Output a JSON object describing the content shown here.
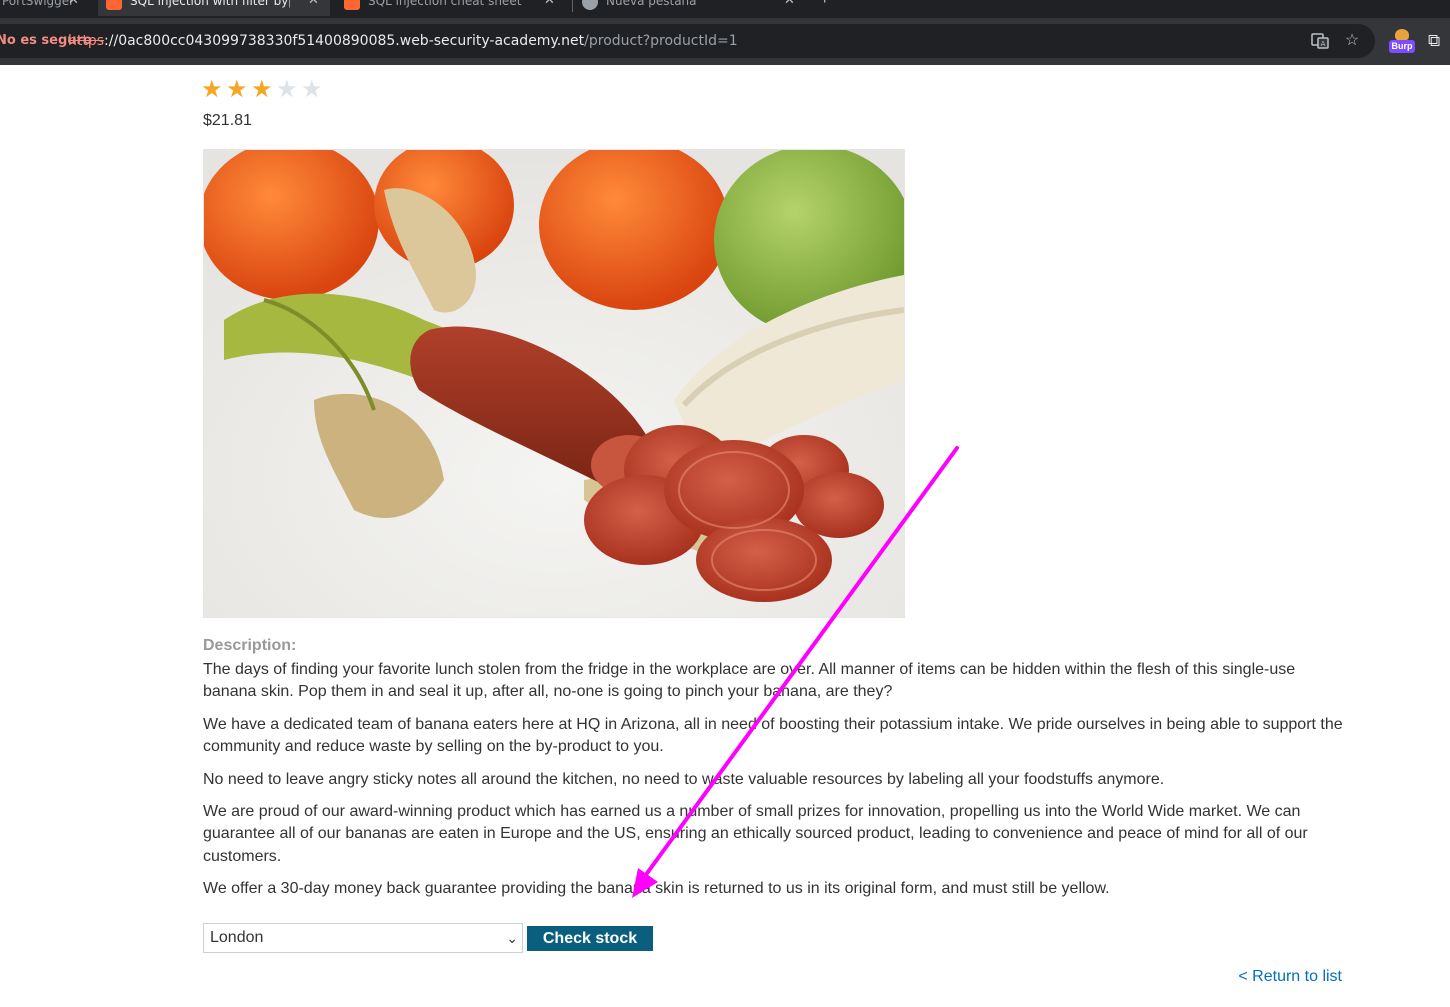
{
  "browser": {
    "tabs": [
      {
        "label": "PortSwigger"
      },
      {
        "label": "SQL injection with filter bypass"
      },
      {
        "label": "SQL injection cheat sheet"
      },
      {
        "label": "Nueva pestaña"
      }
    ],
    "security_chip": "No es seguro",
    "url": {
      "protocol": "https",
      "host": "://0ac800cc043099738330f51400890085.web-security-academy.net",
      "path": "/product?productId=1"
    },
    "extensions": {
      "burp_badge": "Burp"
    }
  },
  "product": {
    "rating": {
      "filled": 3,
      "total": 5
    },
    "price": "$21.81",
    "image_alt": "Banana skin with chorizo sausage inside",
    "description_label": "Description:",
    "description": [
      "The days of finding your favorite lunch stolen from the fridge in the workplace are over. All manner of items can be hidden within the flesh of this single-use banana skin. Pop them in and seal it up, after all, no-one is going to pinch your banana, are they?",
      "We have a dedicated team of banana eaters here at HQ in Arizona, all in need of boosting their potassium intake. We pride ourselves in being able to support the community and reduce waste by selling on the by-product to you.",
      "No need to leave angry sticky notes all around the kitchen, no need to waste valuable resources by labeling all your foodstuffs anymore.",
      "We are proud of our award-winning product which has earned us a number of small prizes for innovation, propelling us into the World Wide market. We can guarantee all of our bananas are eaten in Europe and the US, ensuring an ethically sourced product, leading to convenience and peace of mind for all of our customers.",
      "We offer a 30-day money back guarantee providing the banana skin is returned to us in its original form, and must still be yellow."
    ]
  },
  "stock_form": {
    "store_selected": "London",
    "check_button": "Check stock"
  },
  "return_link": "< Return to list",
  "colors": {
    "star_filled": "#f5a623",
    "star_empty": "#dde3e6",
    "button_bg": "#0b5f7e",
    "link": "#0071bc",
    "annotation_arrow": "#ff00ff"
  }
}
